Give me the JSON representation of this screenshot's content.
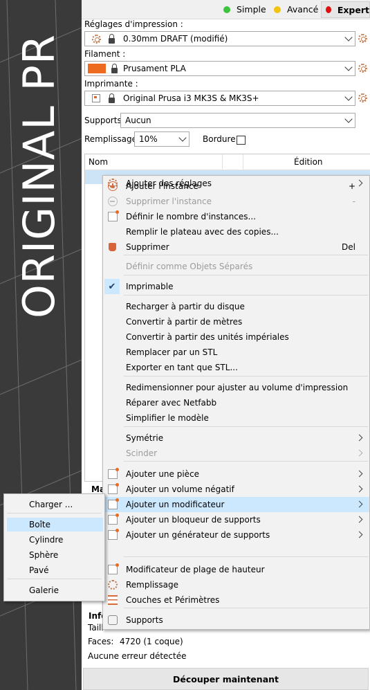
{
  "viewport": {
    "bed_text": "ORIGINAL PR"
  },
  "modes": [
    {
      "label": "Simple",
      "color": "#3cc43c"
    },
    {
      "label": "Avancé",
      "color": "#f2c40f"
    },
    {
      "label": "Expert",
      "color": "#e01010"
    }
  ],
  "print_settings": {
    "label": "Réglages d'impression :",
    "value": "0.30mm DRAFT (modifié)"
  },
  "filament": {
    "label": "Filament :",
    "value": "Prusament PLA",
    "color": "#ed6b21"
  },
  "printer": {
    "label": "Imprimante :",
    "value": "Original Prusa i3 MK3S & MK3S+"
  },
  "supports": {
    "label": "Supports:",
    "value": "Aucun"
  },
  "infill": {
    "label": "Remplissage:",
    "value": "10%"
  },
  "brim": {
    "label": "Bordure:",
    "checked": false
  },
  "object_list": {
    "col_name": "Nom",
    "col_edit": "Édition"
  },
  "manip_label": "Ma",
  "info": {
    "header": "Info",
    "size_label": "Taill",
    "faces_label": "Faces:",
    "faces_value": "4720 (1 coque)",
    "errors": "Aucune erreur détectée"
  },
  "slice_button": "Découper maintenant",
  "context_menu": [
    {
      "label": "Ajouter l'instance",
      "shortcut": "+",
      "icon": "add-instance-icon"
    },
    {
      "label": "Supprimer l'instance",
      "shortcut": "-",
      "disabled": true,
      "icon": "remove-instance-icon"
    },
    {
      "label": "Définir le nombre d'instances...",
      "icon": "set-instances-icon"
    },
    {
      "label": "Remplir le plateau avec des copies..."
    },
    {
      "label": "Supprimer",
      "shortcut": "Del",
      "icon": "delete-icon"
    },
    {
      "label": "Définir comme Objets Séparés",
      "disabled": true
    },
    {
      "label": "Imprimable",
      "checked": true
    },
    {
      "label": "Recharger à partir du disque"
    },
    {
      "label": "Convertir à partir de mètres"
    },
    {
      "label": "Convertir à partir des unités impériales"
    },
    {
      "label": "Remplacer par un STL"
    },
    {
      "label": "Exporter en tant que STL..."
    },
    {
      "label": "Redimensionner pour ajuster au volume d'impression"
    },
    {
      "label": "Réparer avec Netfabb"
    },
    {
      "label": "Simplifier le modèle"
    },
    {
      "label": "Symétrie",
      "submenu": true
    },
    {
      "label": "Scinder",
      "submenu": true,
      "disabled": true
    },
    {
      "label": "Ajouter une pièce",
      "submenu": true,
      "icon": "add-part-icon"
    },
    {
      "label": "Ajouter un volume négatif",
      "submenu": true,
      "icon": "add-negative-volume-icon"
    },
    {
      "label": "Ajouter un modificateur",
      "submenu": true,
      "highlighted": true,
      "icon": "add-modifier-icon"
    },
    {
      "label": "Ajouter un bloqueur de supports",
      "submenu": true,
      "icon": "support-blocker-icon"
    },
    {
      "label": "Ajouter un générateur de supports",
      "submenu": true,
      "icon": "support-enforcer-icon"
    },
    {
      "label": "Modificateur de plage de hauteur",
      "icon": "height-range-icon"
    },
    {
      "label": "Remplissage",
      "icon": "infill-icon"
    },
    {
      "label": "Couches et Périmètres",
      "icon": "layers-icon"
    },
    {
      "label": "Supports",
      "icon": "supports-icon"
    },
    {
      "label": "Ajouter des réglages",
      "submenu": true,
      "icon": "add-settings-icon"
    }
  ],
  "submenu": [
    {
      "label": "Charger ..."
    },
    {
      "label": "Boîte",
      "highlighted": true
    },
    {
      "label": "Cylindre"
    },
    {
      "label": "Sphère"
    },
    {
      "label": "Pavé"
    },
    {
      "label": "Galerie"
    }
  ]
}
